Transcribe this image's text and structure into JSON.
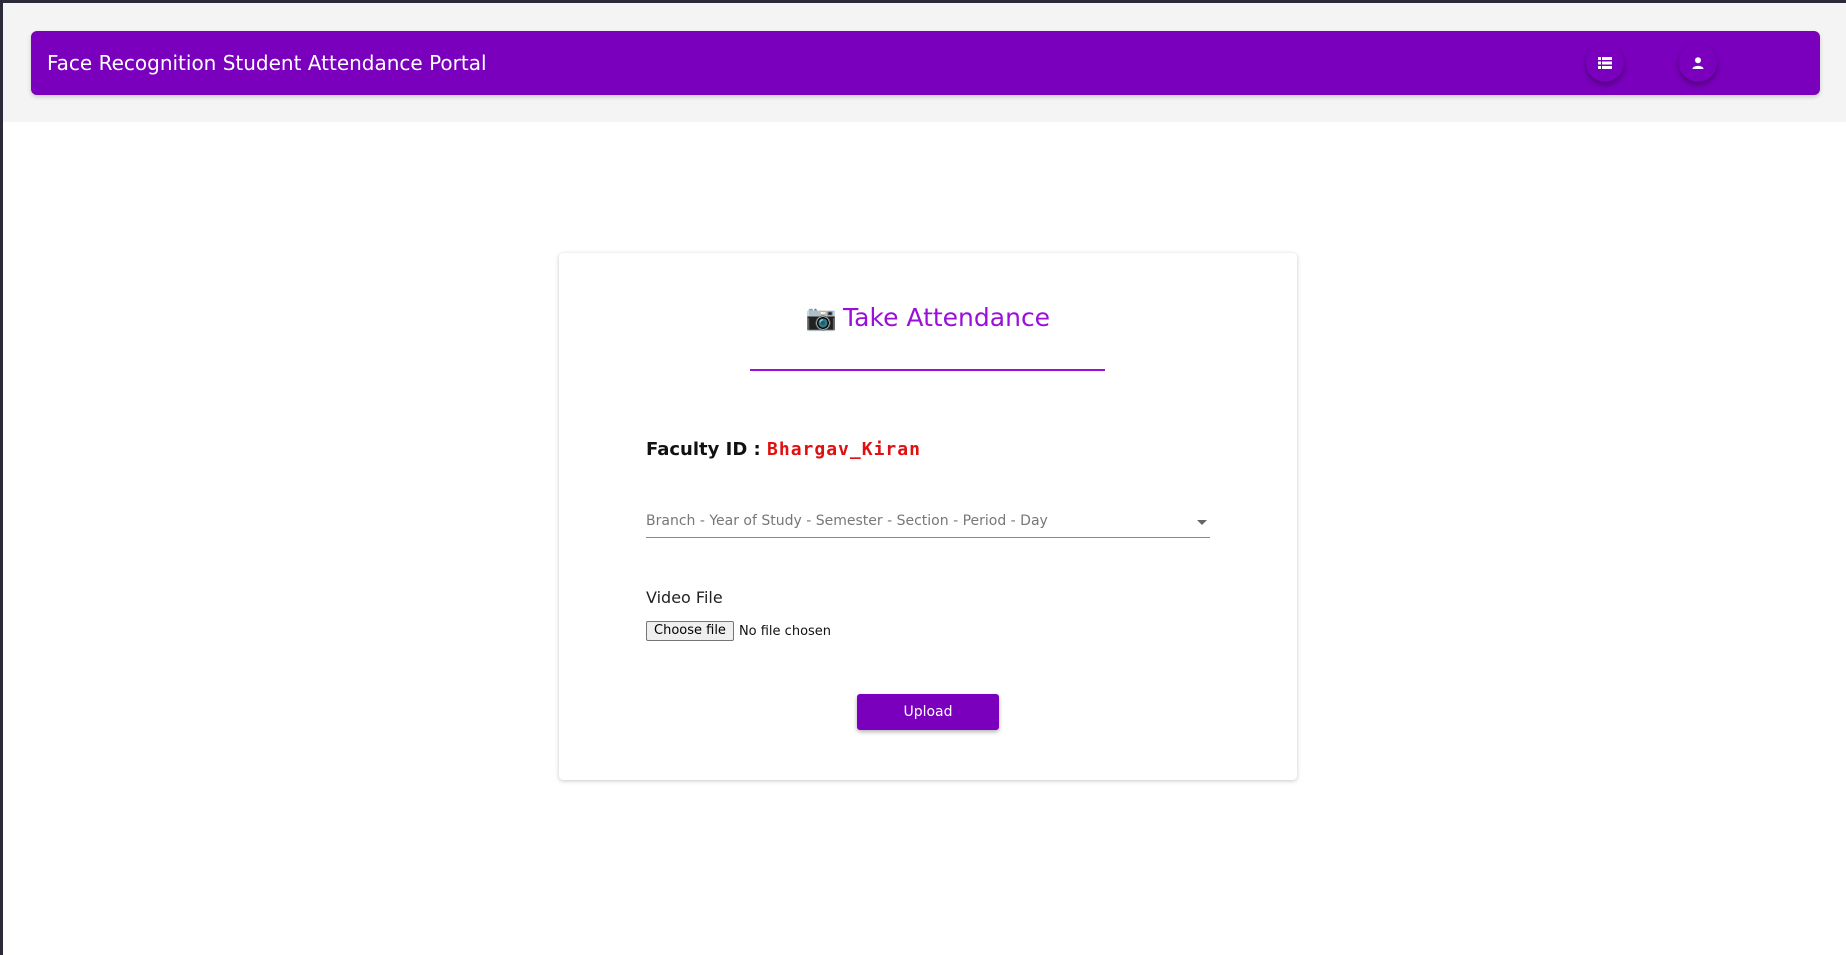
{
  "navbar": {
    "title": "Face Recognition Student Attendance Portal",
    "list_icon": "list-icon",
    "user_icon": "user-icon"
  },
  "card": {
    "camera_icon": "📷",
    "title": "Take Attendance",
    "faculty_label": "Faculty ID :",
    "faculty_id": "Bhargav_Kiran",
    "class_select": {
      "placeholder": "Branch - Year of Study - Semester - Section - Period - Day"
    },
    "video_label": "Video File",
    "file_button": "Choose file",
    "file_status": "No file chosen",
    "upload_button": "Upload"
  },
  "colors": {
    "brand": "#7a00bd",
    "title_accent": "#9a10d8",
    "faculty_id": "#e01010"
  }
}
